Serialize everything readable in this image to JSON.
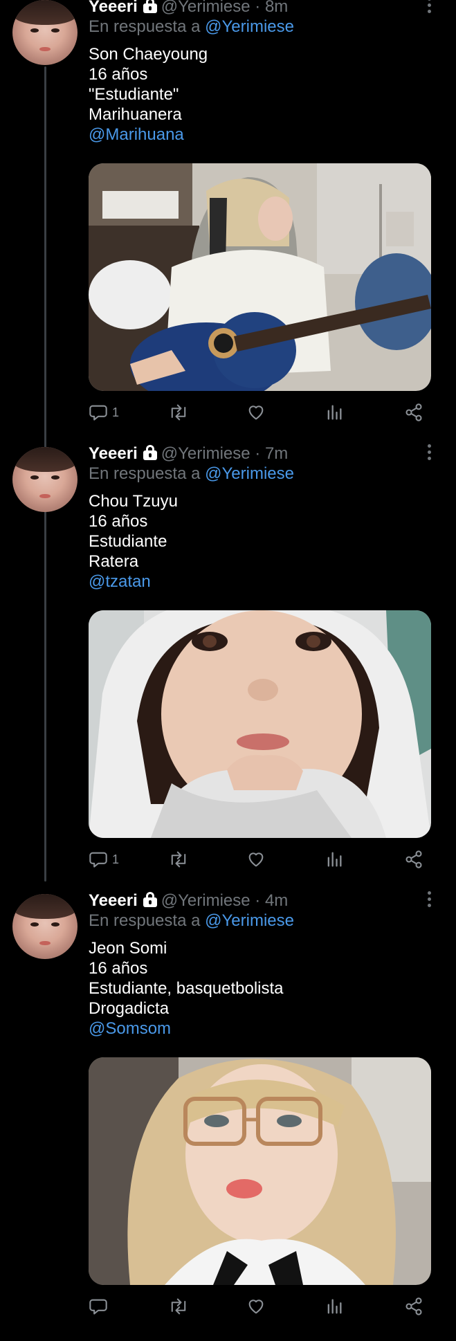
{
  "tweets": [
    {
      "display_name": "Yeeeri",
      "handle": "@Yerimiese",
      "separator": "·",
      "time": "8m",
      "reply_prefix": "En respuesta a",
      "reply_to": "@Yerimiese",
      "lines": [
        "Son Chaeyoung",
        "16 años",
        "\"Estudiante\"",
        "Marihuanera"
      ],
      "mention": "@Marihuana",
      "reply_count": "1"
    },
    {
      "display_name": "Yeeeri",
      "handle": "@Yerimiese",
      "separator": "·",
      "time": "7m",
      "reply_prefix": "En respuesta a",
      "reply_to": "@Yerimiese",
      "lines": [
        "Chou Tzuyu",
        "16 años",
        "Estudiante",
        "Ratera"
      ],
      "mention": "@tzatan",
      "reply_count": "1"
    },
    {
      "display_name": "Yeeeri",
      "handle": "@Yerimiese",
      "separator": "·",
      "time": "4m",
      "reply_prefix": "En respuesta a",
      "reply_to": "@Yerimiese",
      "lines": [
        "Jeon Somi",
        "16 años",
        "Estudiante, basquetbolista",
        "Drogadicta"
      ],
      "mention": "@Somsom",
      "reply_count": ""
    }
  ],
  "colors": {
    "background": "#000000",
    "text": "#ffffff",
    "secondary": "#71767b",
    "link": "#4a99e9",
    "thread_line": "#3a3f44"
  },
  "icons": [
    "lock-icon",
    "more-icon",
    "reply-icon",
    "retweet-icon",
    "like-icon",
    "views-icon",
    "share-icon"
  ]
}
